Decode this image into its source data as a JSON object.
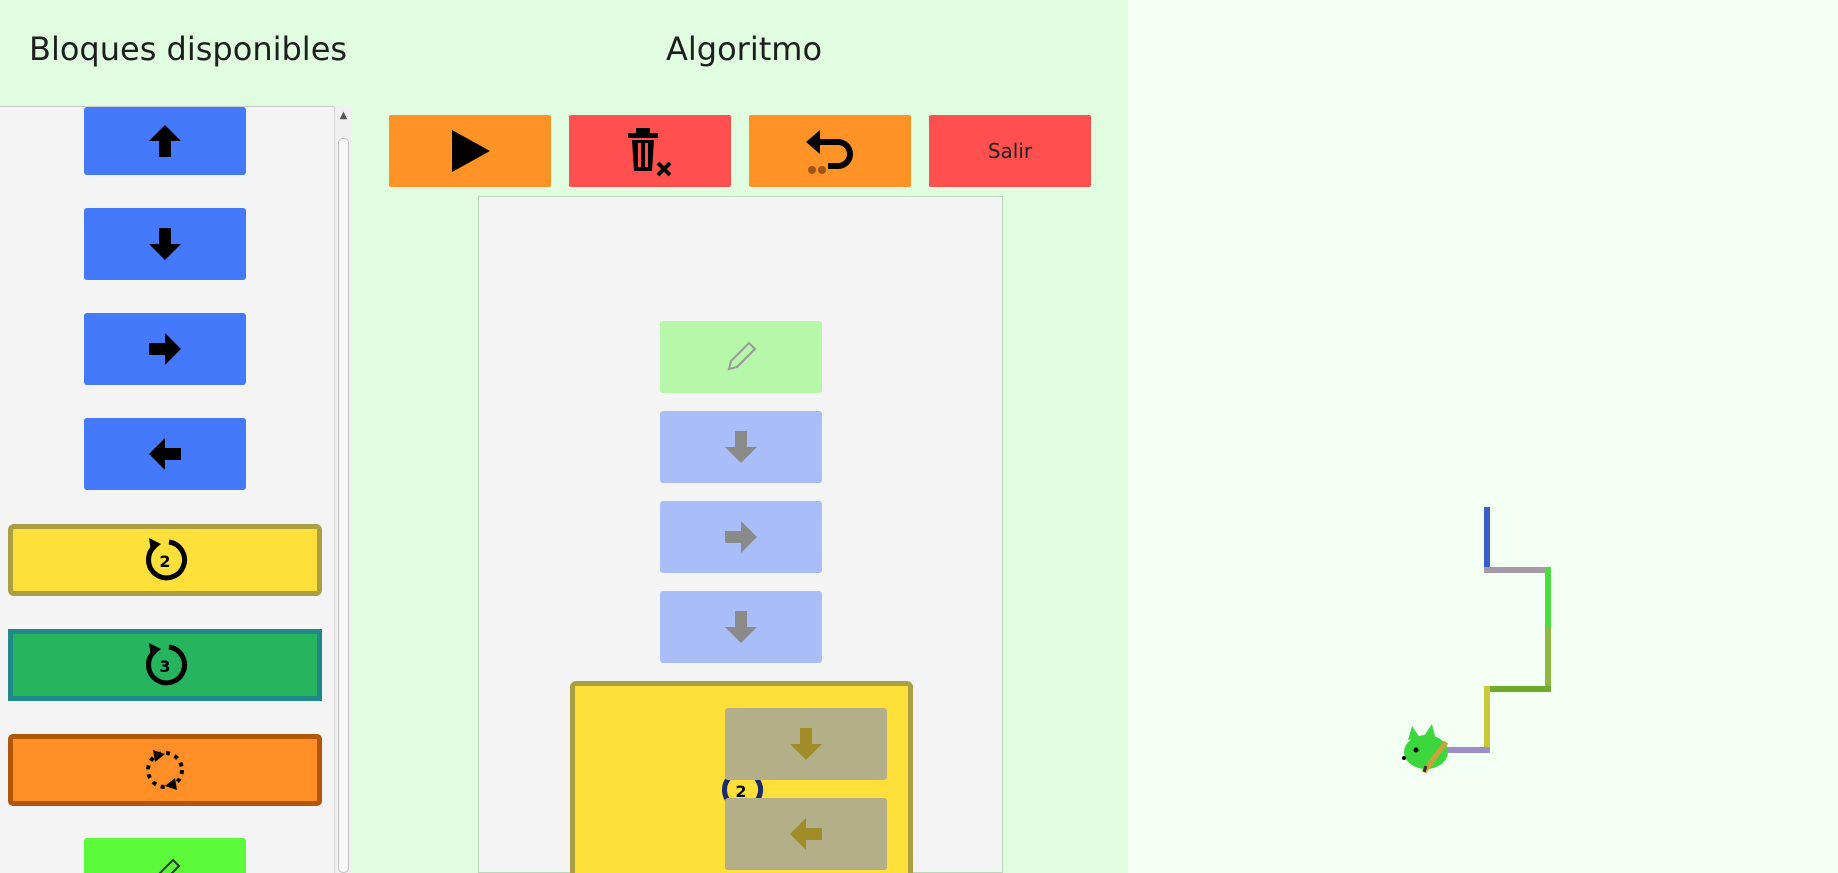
{
  "headers": {
    "available_blocks": "Bloques disponibles",
    "algorithm": "Algoritmo"
  },
  "toolbar": {
    "run_icon": "play-icon",
    "clear_icon": "trash-clear-icon",
    "undo_icon": "undo-icon",
    "exit_label": "Salir"
  },
  "palette": {
    "blocks": [
      {
        "name": "move-up",
        "icon": "arrow-up-icon",
        "color": "#4479fb"
      },
      {
        "name": "move-down",
        "icon": "arrow-down-icon",
        "color": "#4479fb"
      },
      {
        "name": "move-right",
        "icon": "arrow-right-icon",
        "color": "#4479fb"
      },
      {
        "name": "move-left",
        "icon": "arrow-left-icon",
        "color": "#4479fb"
      },
      {
        "name": "repeat-2",
        "icon": "repeat-icon",
        "count": "2",
        "color": "#ffe03a"
      },
      {
        "name": "repeat-3",
        "icon": "repeat-icon",
        "count": "3",
        "color": "#27b45f"
      },
      {
        "name": "repeat-forever",
        "icon": "loop-icon",
        "color": "#ff8f26"
      },
      {
        "name": "pencil",
        "icon": "pencil-icon",
        "color": "#5dfa3a"
      }
    ]
  },
  "algorithm": {
    "blocks": [
      {
        "name": "pencil",
        "icon": "pencil-icon"
      },
      {
        "name": "move-down",
        "icon": "arrow-down-icon"
      },
      {
        "name": "move-right",
        "icon": "arrow-right-icon"
      },
      {
        "name": "move-down",
        "icon": "arrow-down-icon"
      },
      {
        "name": "repeat-2",
        "count": "2",
        "children": [
          "arrow-down-icon",
          "arrow-left-icon"
        ]
      }
    ]
  },
  "stage": {
    "character": "green-cat-with-pencil",
    "path_colors": [
      "#3b5bc8",
      "#a49aa8",
      "#4cdc40",
      "#8fb63e",
      "#6faa2a",
      "#c8c83a",
      "#9b8ec8"
    ]
  }
}
